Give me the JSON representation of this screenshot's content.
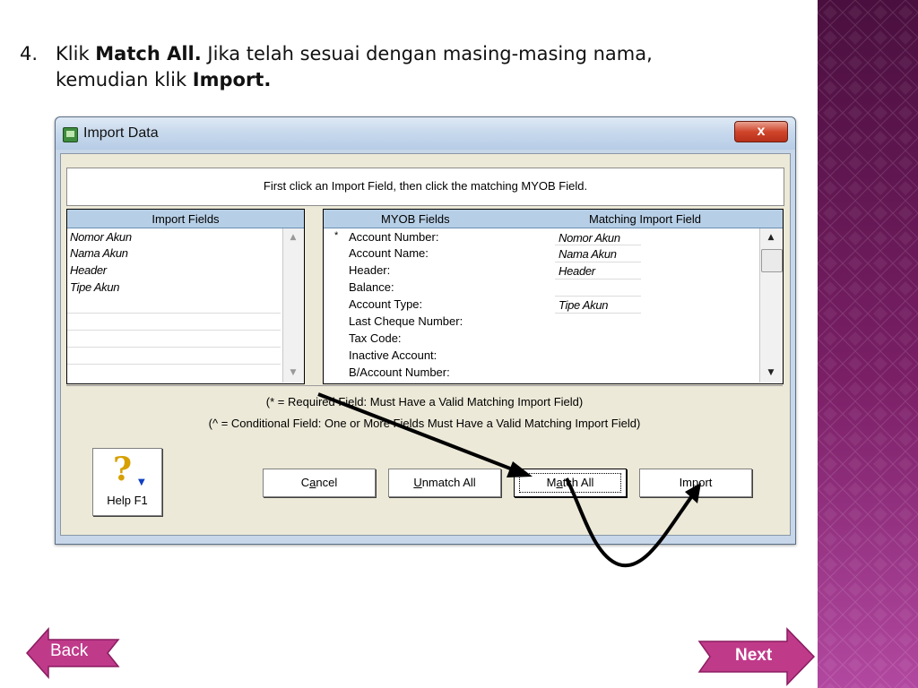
{
  "instruction": {
    "number": "4.",
    "line1_pre": "Klik ",
    "line1_bold": "Match All.",
    "line1_post": " Jika telah sesuai dengan masing-masing nama,",
    "line2_pre": "kemudian klik ",
    "line2_bold": "Import."
  },
  "dialog": {
    "title": "Import Data",
    "close_label": "x",
    "instruction": "First click an Import Field, then click the matching MYOB Field.",
    "import_fields": {
      "header": "Import Fields",
      "items": [
        "Nomor Akun",
        "Nama Akun",
        "Header",
        "Tipe Akun"
      ]
    },
    "myob_fields": {
      "header_left": "MYOB Fields",
      "header_right": "Matching Import Field",
      "rows": [
        {
          "mark": "*",
          "field": "Account Number:",
          "match": "Nomor Akun"
        },
        {
          "mark": "",
          "field": "Account Name:",
          "match": "Nama Akun"
        },
        {
          "mark": "",
          "field": "Header:",
          "match": "Header"
        },
        {
          "mark": "",
          "field": "Balance:",
          "match": ""
        },
        {
          "mark": "",
          "field": "Account Type:",
          "match": "Tipe Akun"
        },
        {
          "mark": "",
          "field": "Last Cheque Number:",
          "match": ""
        },
        {
          "mark": "",
          "field": "Tax Code:",
          "match": ""
        },
        {
          "mark": "",
          "field": "Inactive Account:",
          "match": ""
        },
        {
          "mark": "",
          "field": "B/Account Number:",
          "match": ""
        }
      ]
    },
    "note_required": "(* = Required Field:  Must Have a Valid Matching Import Field)",
    "note_conditional": "(^ = Conditional Field:  One or More Fields Must Have a Valid Matching Import Field)",
    "buttons": {
      "help": "Help F1",
      "cancel_a": "C",
      "cancel_u": "a",
      "cancel_b": "ncel",
      "unmatch_u": "U",
      "unmatch_b": "nmatch All",
      "match_a": "M",
      "match_u": "a",
      "match_b": "tch All",
      "import_a": "Im",
      "import_u": "p",
      "import_b": "ort"
    }
  },
  "nav": {
    "back": "Back",
    "next": "Next"
  },
  "colors": {
    "accent": "#c03a8a",
    "sidebar_top": "#4a0f3e",
    "sidebar_bottom": "#b248a0",
    "title_bar": "#c6d8ec",
    "close_button": "#d0462c"
  }
}
